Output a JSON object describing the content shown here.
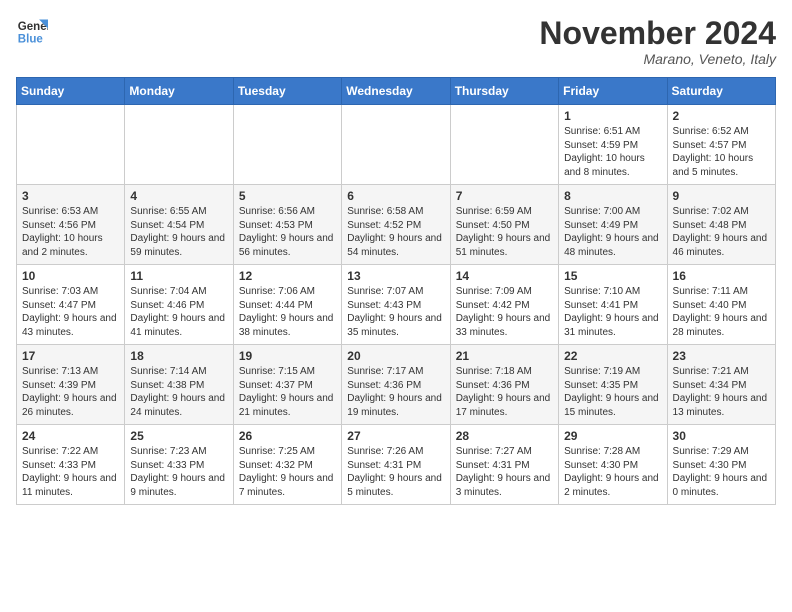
{
  "logo": {
    "line1": "General",
    "line2": "Blue"
  },
  "title": "November 2024",
  "location": "Marano, Veneto, Italy",
  "headers": [
    "Sunday",
    "Monday",
    "Tuesday",
    "Wednesday",
    "Thursday",
    "Friday",
    "Saturday"
  ],
  "weeks": [
    [
      {
        "day": "",
        "info": ""
      },
      {
        "day": "",
        "info": ""
      },
      {
        "day": "",
        "info": ""
      },
      {
        "day": "",
        "info": ""
      },
      {
        "day": "",
        "info": ""
      },
      {
        "day": "1",
        "info": "Sunrise: 6:51 AM\nSunset: 4:59 PM\nDaylight: 10 hours and 8 minutes."
      },
      {
        "day": "2",
        "info": "Sunrise: 6:52 AM\nSunset: 4:57 PM\nDaylight: 10 hours and 5 minutes."
      }
    ],
    [
      {
        "day": "3",
        "info": "Sunrise: 6:53 AM\nSunset: 4:56 PM\nDaylight: 10 hours and 2 minutes."
      },
      {
        "day": "4",
        "info": "Sunrise: 6:55 AM\nSunset: 4:54 PM\nDaylight: 9 hours and 59 minutes."
      },
      {
        "day": "5",
        "info": "Sunrise: 6:56 AM\nSunset: 4:53 PM\nDaylight: 9 hours and 56 minutes."
      },
      {
        "day": "6",
        "info": "Sunrise: 6:58 AM\nSunset: 4:52 PM\nDaylight: 9 hours and 54 minutes."
      },
      {
        "day": "7",
        "info": "Sunrise: 6:59 AM\nSunset: 4:50 PM\nDaylight: 9 hours and 51 minutes."
      },
      {
        "day": "8",
        "info": "Sunrise: 7:00 AM\nSunset: 4:49 PM\nDaylight: 9 hours and 48 minutes."
      },
      {
        "day": "9",
        "info": "Sunrise: 7:02 AM\nSunset: 4:48 PM\nDaylight: 9 hours and 46 minutes."
      }
    ],
    [
      {
        "day": "10",
        "info": "Sunrise: 7:03 AM\nSunset: 4:47 PM\nDaylight: 9 hours and 43 minutes."
      },
      {
        "day": "11",
        "info": "Sunrise: 7:04 AM\nSunset: 4:46 PM\nDaylight: 9 hours and 41 minutes."
      },
      {
        "day": "12",
        "info": "Sunrise: 7:06 AM\nSunset: 4:44 PM\nDaylight: 9 hours and 38 minutes."
      },
      {
        "day": "13",
        "info": "Sunrise: 7:07 AM\nSunset: 4:43 PM\nDaylight: 9 hours and 35 minutes."
      },
      {
        "day": "14",
        "info": "Sunrise: 7:09 AM\nSunset: 4:42 PM\nDaylight: 9 hours and 33 minutes."
      },
      {
        "day": "15",
        "info": "Sunrise: 7:10 AM\nSunset: 4:41 PM\nDaylight: 9 hours and 31 minutes."
      },
      {
        "day": "16",
        "info": "Sunrise: 7:11 AM\nSunset: 4:40 PM\nDaylight: 9 hours and 28 minutes."
      }
    ],
    [
      {
        "day": "17",
        "info": "Sunrise: 7:13 AM\nSunset: 4:39 PM\nDaylight: 9 hours and 26 minutes."
      },
      {
        "day": "18",
        "info": "Sunrise: 7:14 AM\nSunset: 4:38 PM\nDaylight: 9 hours and 24 minutes."
      },
      {
        "day": "19",
        "info": "Sunrise: 7:15 AM\nSunset: 4:37 PM\nDaylight: 9 hours and 21 minutes."
      },
      {
        "day": "20",
        "info": "Sunrise: 7:17 AM\nSunset: 4:36 PM\nDaylight: 9 hours and 19 minutes."
      },
      {
        "day": "21",
        "info": "Sunrise: 7:18 AM\nSunset: 4:36 PM\nDaylight: 9 hours and 17 minutes."
      },
      {
        "day": "22",
        "info": "Sunrise: 7:19 AM\nSunset: 4:35 PM\nDaylight: 9 hours and 15 minutes."
      },
      {
        "day": "23",
        "info": "Sunrise: 7:21 AM\nSunset: 4:34 PM\nDaylight: 9 hours and 13 minutes."
      }
    ],
    [
      {
        "day": "24",
        "info": "Sunrise: 7:22 AM\nSunset: 4:33 PM\nDaylight: 9 hours and 11 minutes."
      },
      {
        "day": "25",
        "info": "Sunrise: 7:23 AM\nSunset: 4:33 PM\nDaylight: 9 hours and 9 minutes."
      },
      {
        "day": "26",
        "info": "Sunrise: 7:25 AM\nSunset: 4:32 PM\nDaylight: 9 hours and 7 minutes."
      },
      {
        "day": "27",
        "info": "Sunrise: 7:26 AM\nSunset: 4:31 PM\nDaylight: 9 hours and 5 minutes."
      },
      {
        "day": "28",
        "info": "Sunrise: 7:27 AM\nSunset: 4:31 PM\nDaylight: 9 hours and 3 minutes."
      },
      {
        "day": "29",
        "info": "Sunrise: 7:28 AM\nSunset: 4:30 PM\nDaylight: 9 hours and 2 minutes."
      },
      {
        "day": "30",
        "info": "Sunrise: 7:29 AM\nSunset: 4:30 PM\nDaylight: 9 hours and 0 minutes."
      }
    ]
  ]
}
